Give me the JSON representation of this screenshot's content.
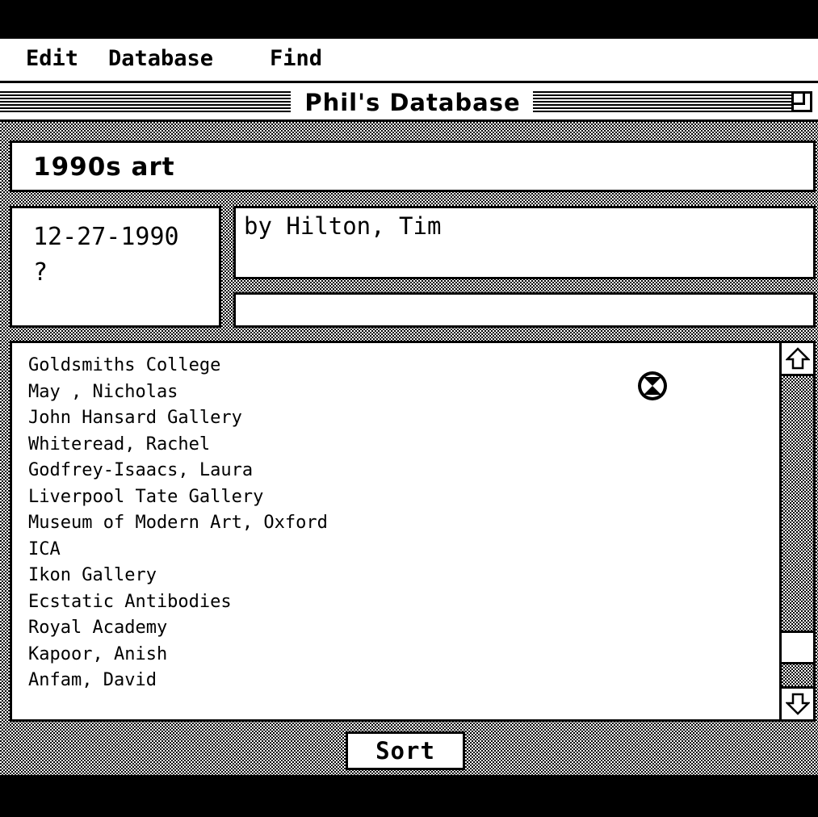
{
  "menubar": {
    "items": [
      {
        "label": "Edit"
      },
      {
        "label": "Database"
      },
      {
        "label": "Find"
      }
    ]
  },
  "window": {
    "title": "Phil's Database"
  },
  "record": {
    "title": "1990s art",
    "date": "12-27-1990",
    "date_note": "?",
    "author": "by Hilton, Tim",
    "extra": ""
  },
  "list": {
    "items": [
      "Goldsmiths College",
      "May , Nicholas",
      "John Hansard Gallery",
      "Whiteread, Rachel",
      "Godfrey-Isaacs, Laura",
      "Liverpool Tate Gallery",
      "Museum of Modern Art, Oxford",
      "ICA",
      "Ikon Gallery",
      "Ecstatic Antibodies",
      "Royal Academy",
      "Kapoor, Anish",
      "Anfam, David"
    ],
    "scroll_position": 0.92
  },
  "buttons": {
    "sort_label": "Sort"
  },
  "icons": {
    "wait": "hourglass-icon",
    "zoom": "zoom-box-icon",
    "scroll_up": "arrow-up-icon",
    "scroll_down": "arrow-down-icon"
  }
}
